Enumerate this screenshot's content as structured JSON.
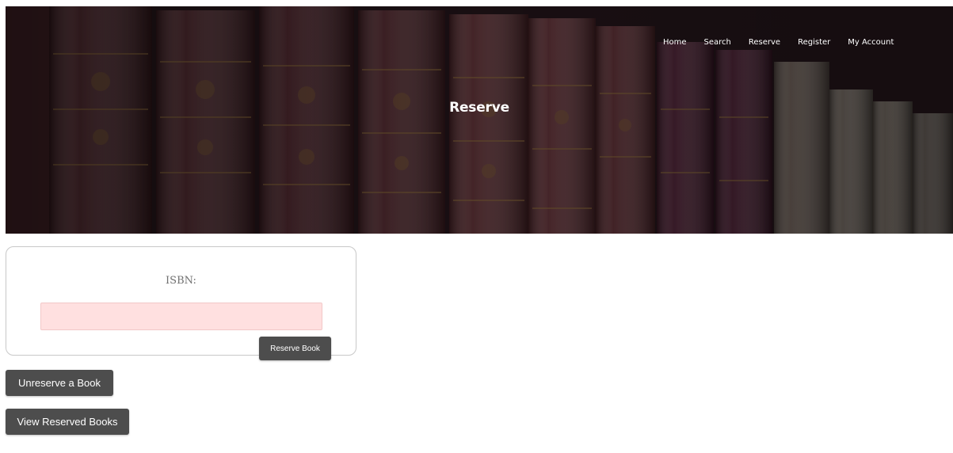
{
  "header": {
    "title": "Reserve",
    "nav": [
      {
        "label": "Home"
      },
      {
        "label": "Search"
      },
      {
        "label": "Reserve"
      },
      {
        "label": "Register"
      },
      {
        "label": "My Account"
      }
    ],
    "background_image": "library-books-image"
  },
  "reserve_form": {
    "isbn_label": "ISBN:",
    "isbn_value": "",
    "submit_label": "Reserve Book"
  },
  "actions": {
    "unreserve_label": "Unreserve a Book",
    "view_reserved_label": "View Reserved Books"
  },
  "colors": {
    "button_bg": "#4d4d4d",
    "input_bg": "#ffe0e0",
    "hero_overlay": "#1e1214"
  }
}
